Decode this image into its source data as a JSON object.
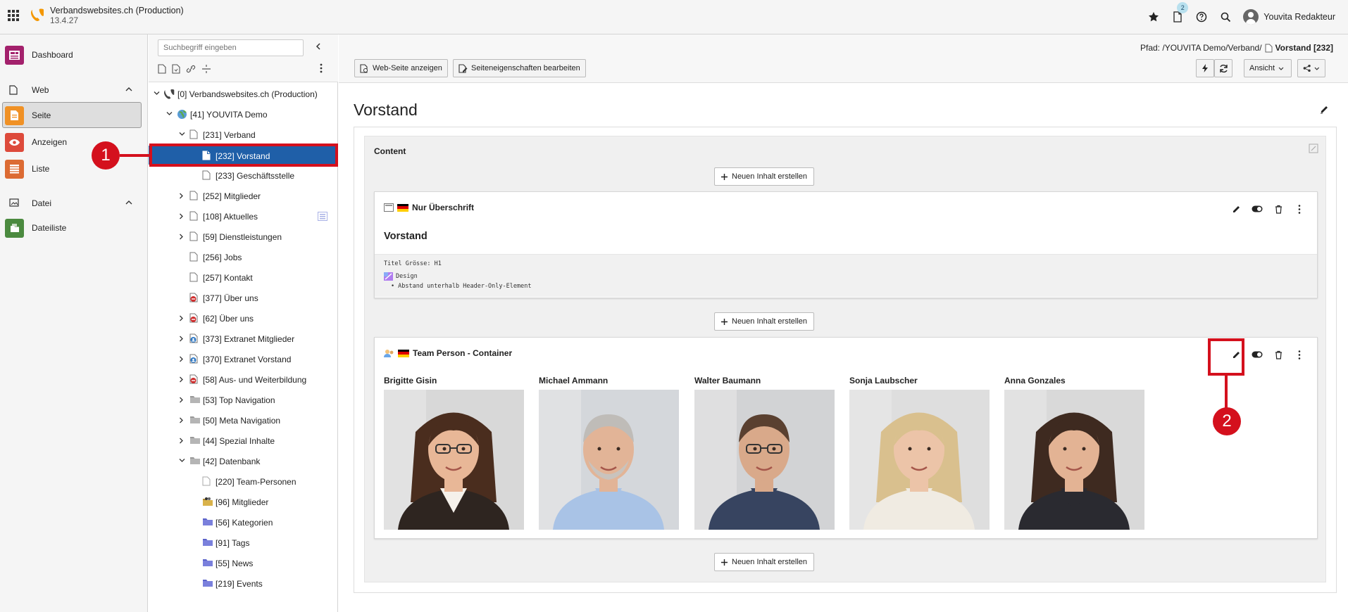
{
  "app": {
    "site_title": "Verbandswebsites.ch (Production)",
    "version": "13.4.27",
    "notification_count": "2",
    "user_name": "Youvita Redakteur"
  },
  "modules": {
    "dashboard": "Dashboard",
    "web_group": "Web",
    "seite": "Seite",
    "anzeigen": "Anzeigen",
    "liste": "Liste",
    "datei_group": "Datei",
    "dateiliste": "Dateiliste"
  },
  "tree": {
    "search_placeholder": "Suchbegriff eingeben",
    "nodes": [
      {
        "label": "[0] Verbandswebsites.ch (Production)"
      },
      {
        "label": "[41] YOUVITA Demo"
      },
      {
        "label": "[231] Verband"
      },
      {
        "label": "[232] Vorstand"
      },
      {
        "label": "[233] Geschäftsstelle"
      },
      {
        "label": "[252] Mitglieder"
      },
      {
        "label": "[108] Aktuelles"
      },
      {
        "label": "[59] Dienstleistungen"
      },
      {
        "label": "[256] Jobs"
      },
      {
        "label": "[257] Kontakt"
      },
      {
        "label": "[377] Über uns"
      },
      {
        "label": "[62] Über uns"
      },
      {
        "label": "[373] Extranet Mitglieder"
      },
      {
        "label": "[370] Extranet Vorstand"
      },
      {
        "label": "[58] Aus- und Weiterbildung"
      },
      {
        "label": "[53] Top Navigation"
      },
      {
        "label": "[50] Meta Navigation"
      },
      {
        "label": "[44] Spezial Inhalte"
      },
      {
        "label": "[42] Datenbank"
      },
      {
        "label": "[220] Team-Personen"
      },
      {
        "label": "[96] Mitglieder"
      },
      {
        "label": "[56] Kategorien"
      },
      {
        "label": "[91] Tags"
      },
      {
        "label": "[55] News"
      },
      {
        "label": "[219] Events"
      }
    ]
  },
  "doc": {
    "path_label": "Pfad: /YOUVITA Demo/Verband/",
    "path_current": "Vorstand [232]",
    "btn_view": "Web-Seite anzeigen",
    "btn_props": "Seiteneigenschaften bearbeiten",
    "btn_ansicht": "Ansicht",
    "page_title": "Vorstand"
  },
  "content": {
    "column_title": "Content",
    "new_content": "Neuen Inhalt erstellen",
    "card1": {
      "type_label": "Nur Überschrift",
      "heading": "Vorstand",
      "meta_line": "Titel Grösse: H1",
      "design_label": "Design",
      "design_item": "Abstand unterhalb Header-Only-Element"
    },
    "card2": {
      "type_label": "Team Person - Container",
      "persons": [
        {
          "name": "Brigitte Gisin"
        },
        {
          "name": "Michael Ammann"
        },
        {
          "name": "Walter Baumann"
        },
        {
          "name": "Sonja Laubscher"
        },
        {
          "name": "Anna Gonzales"
        }
      ]
    }
  },
  "annotations": {
    "marker_1": "1",
    "marker_2": "2"
  },
  "colors": {
    "accent_red": "#d4101d",
    "selected_blue": "#1f5fa8",
    "typo3_orange": "#f49700"
  }
}
